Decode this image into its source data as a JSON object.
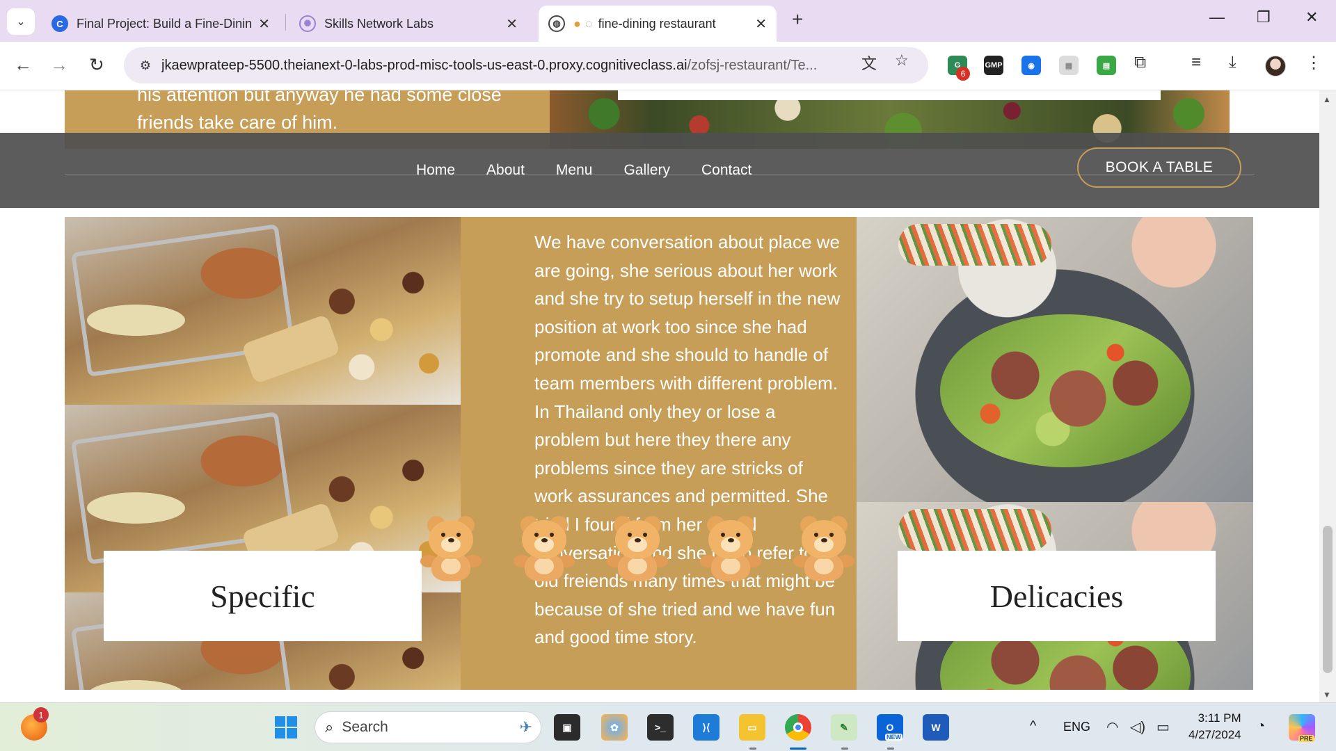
{
  "browser": {
    "tabs": [
      {
        "title": "Final Project: Build a Fine-Dining",
        "favicon": "coursera-icon"
      },
      {
        "title": "Skills Network Labs",
        "favicon": "skills-network-icon"
      },
      {
        "title": "fine-dining restaurant",
        "favicon": "globe-icon"
      }
    ],
    "url": "jkaewprateep-5500.theianext-0-labs-prod-misc-tools-us-east-0.proxy.cognitiveclass.ai",
    "url_path": "/zofsj-restaurant/Te...",
    "extension_badge": "6",
    "ext_gmp_label": "GMP"
  },
  "page": {
    "about_text": "his attention but anyway he had some close friends take care of him.",
    "nav": {
      "links": [
        "Home",
        "About",
        "Menu",
        "Gallery",
        "Contact"
      ],
      "book_button": "BOOK A TABLE"
    },
    "story_text": "We have conversation about place we are going, she serious about her work and she try to setup herself in the new position at work too since she had promote and she should to handle of team members with different problem. In Thailand only they or lose a problem but here they there any problems since they are stricks of work assurances and permitted. She tried I found from her sound conversation and she try to refer to old freiends many times that might be because of she tried and we have fun and good time story.",
    "captions": {
      "left": "Specific",
      "right": "Delicacies"
    },
    "bear_count": 5
  },
  "taskbar": {
    "search_placeholder": "Search",
    "notification_badge": "1",
    "language": "ENG",
    "time": "3:11 PM",
    "date": "4/27/2024",
    "outlook_badge": "NEW",
    "copilot_badge": "PRE"
  },
  "colors": {
    "accent_gold": "#c79e58",
    "navbar": "#505050",
    "tab_bar": "#e9dcf2"
  }
}
